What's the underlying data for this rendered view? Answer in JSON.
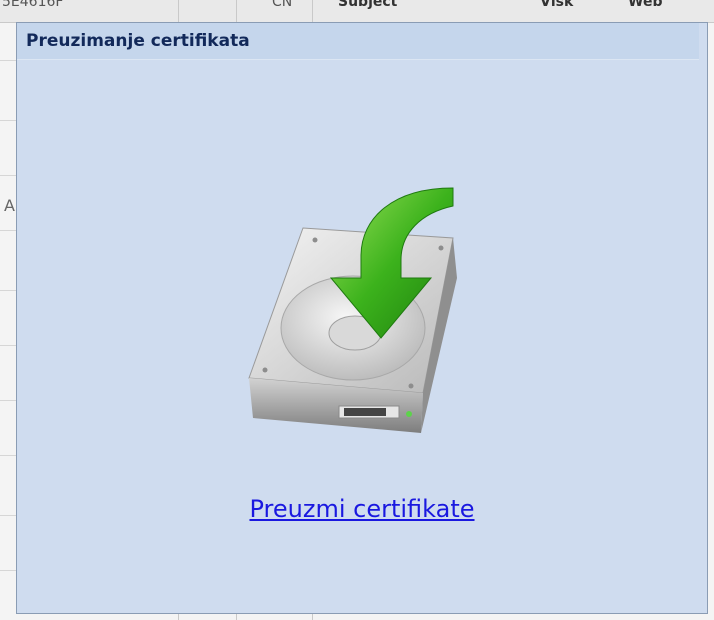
{
  "background": {
    "header_cells": [
      "5E4616F",
      "CN",
      "Subject",
      "Vlsk",
      "Web"
    ],
    "row_fragment": "A"
  },
  "dialog": {
    "title": "Preuzimanje certifikata",
    "icon": "hard-drive-download-icon",
    "link_label": "Preuzmi certifikate"
  },
  "colors": {
    "panel_background": "#cfdcef",
    "title_text": "#12295a",
    "link": "#1a18e0",
    "arrow": "#3cb21c"
  }
}
